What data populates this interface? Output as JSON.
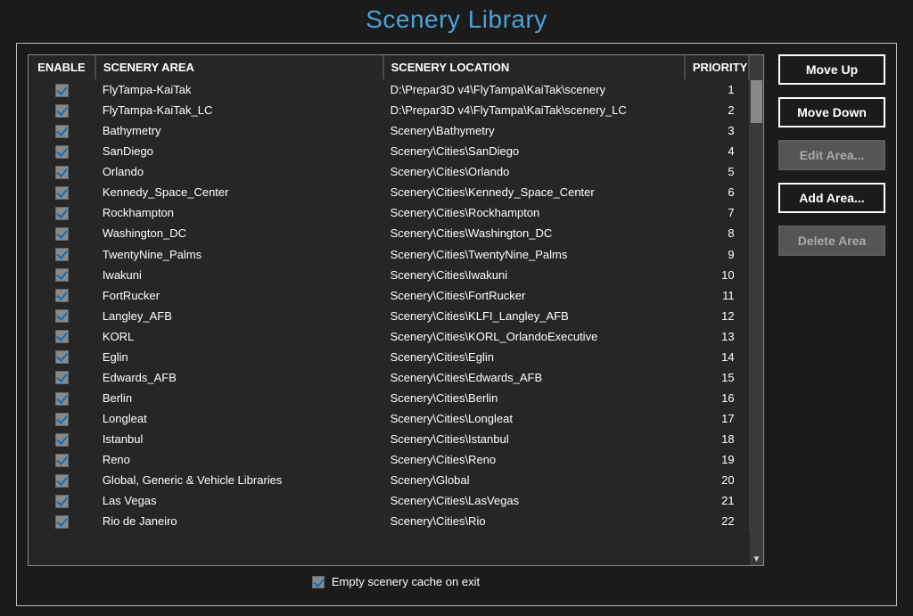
{
  "title": "Scenery Library",
  "columns": {
    "enable": "ENABLE",
    "area": "SCENERY AREA",
    "location": "SCENERY LOCATION",
    "priority": "PRIORITY"
  },
  "rows": [
    {
      "enabled": true,
      "area": "FlyTampa-KaiTak",
      "location": "D:\\Prepar3D v4\\FlyTampa\\KaiTak\\scenery",
      "priority": 1
    },
    {
      "enabled": true,
      "area": "FlyTampa-KaiTak_LC",
      "location": "D:\\Prepar3D v4\\FlyTampa\\KaiTak\\scenery_LC",
      "priority": 2
    },
    {
      "enabled": true,
      "area": "Bathymetry",
      "location": "Scenery\\Bathymetry",
      "priority": 3
    },
    {
      "enabled": true,
      "area": "SanDiego",
      "location": "Scenery\\Cities\\SanDiego",
      "priority": 4
    },
    {
      "enabled": true,
      "area": "Orlando",
      "location": "Scenery\\Cities\\Orlando",
      "priority": 5
    },
    {
      "enabled": true,
      "area": "Kennedy_Space_Center",
      "location": "Scenery\\Cities\\Kennedy_Space_Center",
      "priority": 6
    },
    {
      "enabled": true,
      "area": "Rockhampton",
      "location": "Scenery\\Cities\\Rockhampton",
      "priority": 7
    },
    {
      "enabled": true,
      "area": "Washington_DC",
      "location": "Scenery\\Cities\\Washington_DC",
      "priority": 8
    },
    {
      "enabled": true,
      "area": "TwentyNine_Palms",
      "location": "Scenery\\Cities\\TwentyNine_Palms",
      "priority": 9
    },
    {
      "enabled": true,
      "area": "Iwakuni",
      "location": "Scenery\\Cities\\Iwakuni",
      "priority": 10
    },
    {
      "enabled": true,
      "area": "FortRucker",
      "location": "Scenery\\Cities\\FortRucker",
      "priority": 11
    },
    {
      "enabled": true,
      "area": "Langley_AFB",
      "location": "Scenery\\Cities\\KLFI_Langley_AFB",
      "priority": 12
    },
    {
      "enabled": true,
      "area": "KORL",
      "location": "Scenery\\Cities\\KORL_OrlandoExecutive",
      "priority": 13
    },
    {
      "enabled": true,
      "area": "Eglin",
      "location": "Scenery\\Cities\\Eglin",
      "priority": 14
    },
    {
      "enabled": true,
      "area": "Edwards_AFB",
      "location": "Scenery\\Cities\\Edwards_AFB",
      "priority": 15
    },
    {
      "enabled": true,
      "area": "Berlin",
      "location": "Scenery\\Cities\\Berlin",
      "priority": 16
    },
    {
      "enabled": true,
      "area": "Longleat",
      "location": "Scenery\\Cities\\Longleat",
      "priority": 17
    },
    {
      "enabled": true,
      "area": "Istanbul",
      "location": "Scenery\\Cities\\Istanbul",
      "priority": 18
    },
    {
      "enabled": true,
      "area": "Reno",
      "location": "Scenery\\Cities\\Reno",
      "priority": 19
    },
    {
      "enabled": true,
      "area": "Global, Generic & Vehicle Libraries",
      "location": "Scenery\\Global",
      "priority": 20
    },
    {
      "enabled": true,
      "area": "Las Vegas",
      "location": "Scenery\\Cities\\LasVegas",
      "priority": 21
    },
    {
      "enabled": true,
      "area": "Rio de Janeiro",
      "location": "Scenery\\Cities\\Rio",
      "priority": 22
    }
  ],
  "footer": {
    "empty_cache_checked": true,
    "empty_cache_label": "Empty scenery cache on exit"
  },
  "buttons": {
    "move_up": {
      "label": "Move Up",
      "enabled": true
    },
    "move_down": {
      "label": "Move Down",
      "enabled": true
    },
    "edit_area": {
      "label": "Edit Area...",
      "enabled": false
    },
    "add_area": {
      "label": "Add Area...",
      "enabled": true
    },
    "delete_area": {
      "label": "Delete Area",
      "enabled": false
    }
  }
}
